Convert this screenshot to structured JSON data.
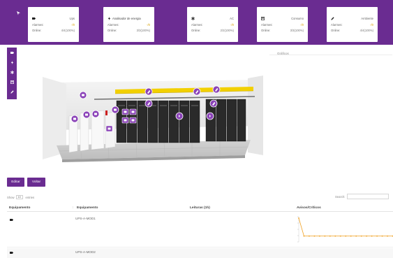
{
  "colors": {
    "brand": "#6a2c91",
    "warning": "#d8a000",
    "marker": "#8b43b8",
    "sparkline": "#f0a020"
  },
  "header": {
    "cards": [
      {
        "icon": "battery-icon",
        "name": "Ups",
        "r2_label": "Alarmes:",
        "r2_value": "-/0",
        "r3_label": "Online:",
        "r3_value": "4/4(100%)"
      },
      {
        "icon": "lightning-icon",
        "name": "Analisador de energia",
        "r2_label": "Alarmes:",
        "r2_value": "-/0",
        "r3_label": "Online:",
        "r3_value": "3/3(100%)"
      },
      {
        "icon": "snowflake-icon",
        "name": "AC",
        "r2_label": "Alarmes:",
        "r2_value": "-/0",
        "r3_label": "Online:",
        "r3_value": "2/2(100%)"
      },
      {
        "icon": "meter-icon",
        "name": "Consumo",
        "r2_label": "Alarmes:",
        "r2_value": "-/0",
        "r3_label": "Online:",
        "r3_value": "3/3(100%)"
      },
      {
        "icon": "pencil-icon",
        "name": "Ambiente",
        "r2_label": "Alarmes:",
        "r2_value": "-/0",
        "r3_label": "Online:",
        "r3_value": "4/4(100%)"
      }
    ]
  },
  "sidebar": {
    "items": [
      {
        "icon": "battery-icon"
      },
      {
        "icon": "lightning-icon"
      },
      {
        "icon": "snowflake-icon"
      },
      {
        "icon": "meter-icon"
      },
      {
        "icon": "pencil-icon"
      }
    ]
  },
  "charts": {
    "label": "Gráficos"
  },
  "buttons": {
    "edit": "Editar",
    "back": "Voltar"
  },
  "table": {
    "show_prefix": "Show",
    "show_value": "10",
    "show_suffix": "entries",
    "search_label": "Search:",
    "search_value": "",
    "columns": [
      "Equipamento",
      "Equipamento",
      "Leituras (1h)",
      "Avisos/Críticos"
    ],
    "rows": [
      {
        "icon": "battery-icon",
        "name": "UPS-A-MOD1",
        "readings": "",
        "alerts": ""
      },
      {
        "icon": "battery-icon",
        "name": "UPS-A-MOD2",
        "readings": "",
        "alerts": ""
      }
    ],
    "sparkline_row1": [
      5,
      1,
      1,
      1,
      1,
      1,
      1,
      1,
      1,
      1,
      1,
      1,
      1,
      1,
      1,
      1,
      1,
      1,
      1,
      1
    ]
  }
}
